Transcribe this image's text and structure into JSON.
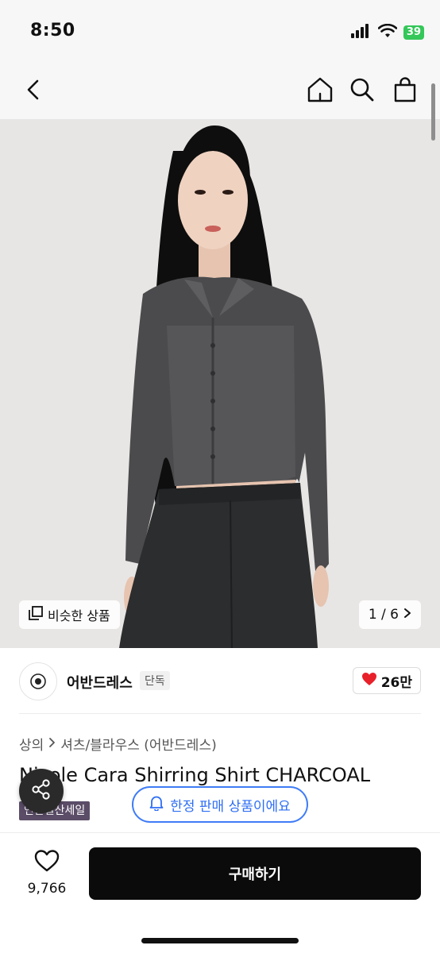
{
  "status_bar": {
    "time": "8:50",
    "battery": "39"
  },
  "hero": {
    "similar_label": "비슷한 상품",
    "counter": "1 / 6"
  },
  "seller": {
    "name": "어반드레스",
    "badge": "단독",
    "likes": "26만"
  },
  "breadcrumb": {
    "category": "상의",
    "subcategory": "셔츠/블라우스 (어반드레스)"
  },
  "product": {
    "title": "Nicole Cara Shirring Shirt CHARCOAL",
    "sale_badge": "연말결산세일"
  },
  "notice": {
    "limited_label": "한정 판매 상품이에요"
  },
  "bottom_bar": {
    "wish_count": "9,766",
    "buy_label": "구매하기"
  },
  "colors": {
    "accent_blue": "#3f7cf7",
    "heart_red": "#e8202a",
    "badge_purple": "#5b4d68",
    "battery_green": "#34c759"
  }
}
